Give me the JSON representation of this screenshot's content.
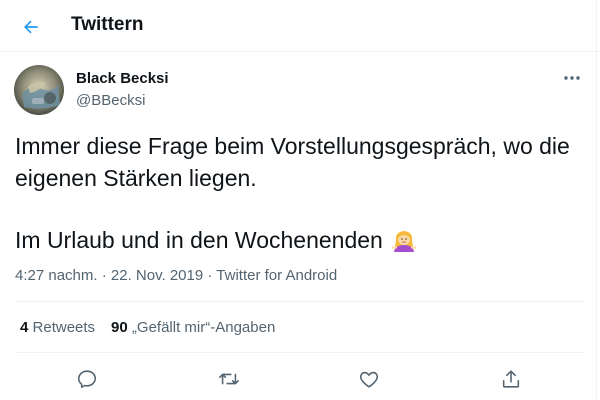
{
  "header": {
    "title": "Twittern",
    "back_icon": "arrow-left-icon",
    "accent_color": "#1d9bf0"
  },
  "author": {
    "display_name": "Black Becksi",
    "handle": "@BBecksi",
    "avatar_icon": "user-avatar-photo"
  },
  "tweet": {
    "lines": [
      "Immer diese Frage beim Vorstellungsgespräch, wo die",
      "eigenen Stärken liegen.",
      "Im Urlaub und in den Wochenenden"
    ],
    "emoji": "person-shrugging-emoji"
  },
  "meta": {
    "time": "4:27 nachm.",
    "separator1": "·",
    "date": "22. Nov. 2019",
    "separator2": "·",
    "source": "Twitter for Android"
  },
  "stats": {
    "retweets_count": "4",
    "retweets_label": "Retweets",
    "likes_count": "90",
    "likes_label": "„Gefällt mir“-Angaben"
  },
  "actions": [
    "reply-icon",
    "retweet-icon",
    "like-icon",
    "share-icon"
  ],
  "colors": {
    "text": "#0f1419",
    "secondary": "#536471",
    "border": "#eff3f4"
  }
}
